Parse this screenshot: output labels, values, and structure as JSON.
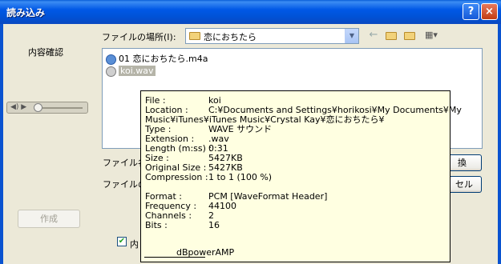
{
  "window": {
    "title": "読み込み",
    "help_glyph": "?",
    "close_glyph": "×"
  },
  "left_panel": {
    "content_check_label": "内容確認",
    "create_button": "作成"
  },
  "location": {
    "label": "ファイルの場所(I):",
    "value": "恋におちたら"
  },
  "toolbar": {
    "back_glyph": "←",
    "view_glyph": "▦▾"
  },
  "files": [
    {
      "name": "01 恋におちたら.m4a",
      "selected": false
    },
    {
      "name": "koi.wav",
      "selected": true
    }
  ],
  "form": {
    "filename_label_partial": "ファイル名",
    "filetype_label_partial": "ファイルの",
    "open_button_partial": "換",
    "cancel_button_partial": "セル",
    "checkbox_label_partial": "内",
    "checkbox_checked": true
  },
  "tooltip": {
    "rows": [
      {
        "key": "File :",
        "value": "koi"
      },
      {
        "key": "Location :",
        "value": "C:¥Documents and Settings¥horikosi¥My Documents¥My"
      },
      {
        "key": "",
        "value": "Music¥iTunes¥iTunes Music¥Crystal Kay¥恋におちたら¥",
        "full": true
      },
      {
        "key": "Type :",
        "value": "WAVE サウンド"
      },
      {
        "key": "Extension :",
        "value": ".wav"
      },
      {
        "key": "Length (m:ss) :",
        "value": "0:31"
      },
      {
        "key": "Size :",
        "value": "5427KB"
      },
      {
        "key": "Original Size :",
        "value": "5427KB"
      },
      {
        "key": "Compression :",
        "value": "1 to 1   (100 %)"
      }
    ],
    "rows2": [
      {
        "key": "Format :",
        "value": "PCM    [WaveFormat Header]"
      },
      {
        "key": "Frequency :",
        "value": "44100"
      },
      {
        "key": "Channels :",
        "value": "2"
      },
      {
        "key": "Bits :",
        "value": "16"
      }
    ],
    "footer": "dBpowerAMP"
  }
}
